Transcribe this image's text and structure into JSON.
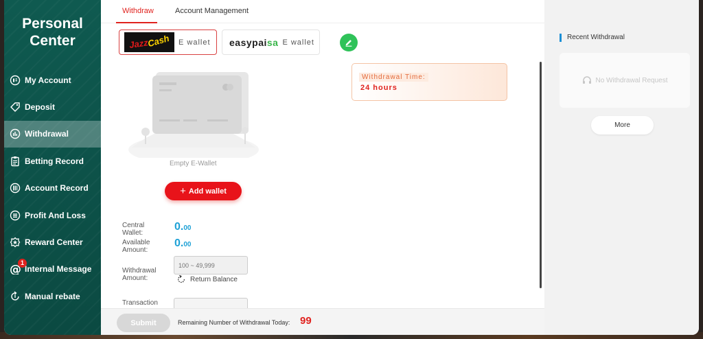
{
  "sidebar": {
    "title_line1": "Personal",
    "title_line2": "Center",
    "items": [
      {
        "label": "My Account",
        "icon": "id-card-icon"
      },
      {
        "label": "Deposit",
        "icon": "tag-icon"
      },
      {
        "label": "Withdrawal",
        "icon": "chart-icon",
        "active": true
      },
      {
        "label": "Betting Record",
        "icon": "clipboard-icon"
      },
      {
        "label": "Account Record",
        "icon": "ledger-icon"
      },
      {
        "label": "Profit And Loss",
        "icon": "list-circle-icon"
      },
      {
        "label": "Reward Center",
        "icon": "gear-badge-icon"
      },
      {
        "label": "Internal Message",
        "icon": "at-icon",
        "badge": "1"
      },
      {
        "label": "Manual rebate",
        "icon": "rebate-icon"
      }
    ]
  },
  "tabs": {
    "withdraw": "Withdraw",
    "account_management": "Account Management"
  },
  "wallets": {
    "jazzcash_logo_a": "Jazz",
    "jazzcash_logo_b": "Cash",
    "jazzcash_label": "E wallet",
    "easypaisa_logo_a": "easypai",
    "easypaisa_logo_b": "sa",
    "easypaisa_label": "E wallet"
  },
  "withdrawal_time": {
    "label": "Withdrawal Time:",
    "value": "24 hours"
  },
  "empty_wallet": {
    "label": "Empty E-Wallet",
    "add_button": "Add wallet"
  },
  "fields": {
    "central_wallet_label_1": "Central",
    "central_wallet_label_2": "Wallet:",
    "central_wallet_int": "0.",
    "central_wallet_dec": "00",
    "available_label_1": "Available",
    "available_label_2": "Amount:",
    "available_int": "0.",
    "available_dec": "00",
    "withdrawal_label_1": "Withdrawal",
    "withdrawal_label_2": "Amount:",
    "withdrawal_placeholder": "100 ~ 49,999",
    "return_balance": "Return Balance",
    "transaction_label": "Transaction"
  },
  "bottom": {
    "submit": "Submit",
    "remaining_label": "Remaining Number of Withdrawal Today:",
    "remaining_count": "99"
  },
  "right_panel": {
    "title": "Recent Withdrawal",
    "empty": "No Withdrawal Request",
    "more": "More"
  },
  "colors": {
    "sidebar_bg": "#0f5a50",
    "accent_red": "#e0221e",
    "amount_blue": "#1ea1d6",
    "edit_green": "#2fc259"
  }
}
